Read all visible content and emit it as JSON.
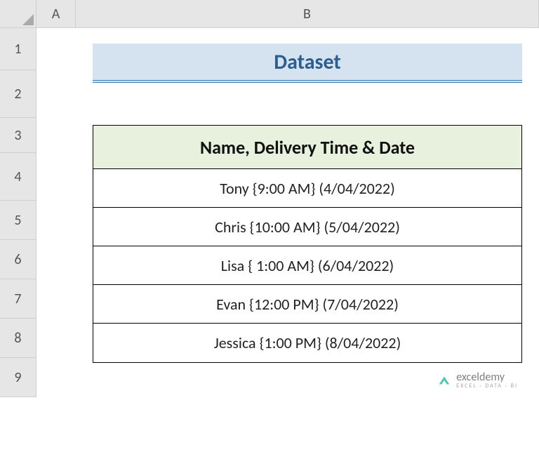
{
  "columns": [
    "A",
    "B"
  ],
  "rows": [
    "1",
    "2",
    "3",
    "4",
    "5",
    "6",
    "7",
    "8",
    "9"
  ],
  "title": "Dataset",
  "table": {
    "header": "Name, Delivery Time & Date",
    "data": [
      "Tony {9:00 AM}  (4/04/2022)",
      "Chris {10:00 AM}  (5/04/2022)",
      "Lisa { 1:00 AM}  (6/04/2022)",
      "Evan {12:00 PM} (7/04/2022)",
      "Jessica {1:00 PM} (8/04/2022)"
    ]
  },
  "watermark": {
    "brand": "exceldemy",
    "tag": "EXCEL · DATA · BI"
  }
}
